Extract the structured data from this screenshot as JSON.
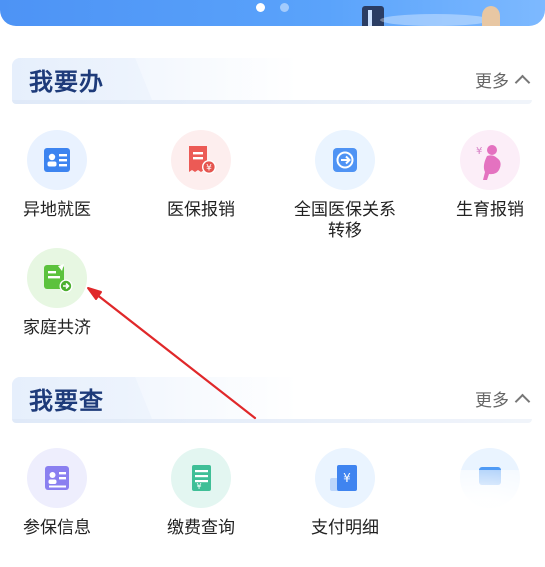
{
  "sections": [
    {
      "title": "我要办",
      "more_label": "更多",
      "items": [
        {
          "label": "异地就医",
          "icon": "id-card-icon"
        },
        {
          "label": "医保报销",
          "icon": "receipt-yen-icon"
        },
        {
          "label": "全国医保关系转移",
          "icon": "transfer-arrow-icon"
        },
        {
          "label": "生育报销",
          "icon": "pregnancy-icon"
        },
        {
          "label": "家庭共济",
          "icon": "family-share-doc-icon"
        }
      ]
    },
    {
      "title": "我要查",
      "more_label": "更多",
      "items": [
        {
          "label": "参保信息",
          "icon": "insured-info-icon"
        },
        {
          "label": "缴费查询",
          "icon": "payment-yen-icon"
        },
        {
          "label": "支付明细",
          "icon": "payment-detail-icon"
        },
        {
          "label": "",
          "icon": "partially-hidden-icon"
        }
      ]
    }
  ],
  "banner": {
    "page_count": 2,
    "active_page": 1
  },
  "colors": {
    "accent": "#4d93f5",
    "section_title": "#1e3b7a",
    "annotation_arrow": "#e0282a"
  }
}
